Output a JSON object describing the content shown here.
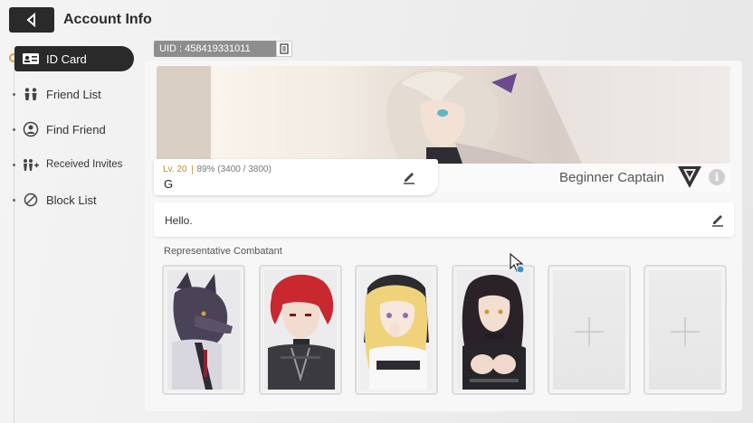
{
  "header": {
    "title": "Account Info"
  },
  "sidebar": {
    "items": [
      {
        "label": "ID Card",
        "icon": "id-card-icon",
        "active": true
      },
      {
        "label": "Friend List",
        "icon": "friends-icon",
        "active": false
      },
      {
        "label": "Find Friend",
        "icon": "find-friend-icon",
        "active": false
      },
      {
        "label": "Received Invites",
        "icon": "invites-icon",
        "active": false
      },
      {
        "label": "Block List",
        "icon": "block-icon",
        "active": false
      }
    ]
  },
  "profile": {
    "uid": "UID : 458419331011",
    "level": "Lv. 20",
    "exp": "89% (3400 / 3800)",
    "name": "G",
    "title": "Beginner Captain",
    "info_symbol": "i",
    "greeting": "Hello."
  },
  "representatives": {
    "section_title": "Representative Combatant",
    "slots": [
      {
        "filled": true,
        "portrait": "wolf-beast-portrait"
      },
      {
        "filled": true,
        "portrait": "red-hair-portrait"
      },
      {
        "filled": true,
        "portrait": "blonde-nun-portrait"
      },
      {
        "filled": true,
        "portrait": "black-hair-portrait"
      },
      {
        "filled": false
      },
      {
        "filled": false
      }
    ]
  },
  "colors": {
    "accent": "#d6a23a",
    "active_bg": "#2a2a2a",
    "level": "#c98a2b"
  }
}
